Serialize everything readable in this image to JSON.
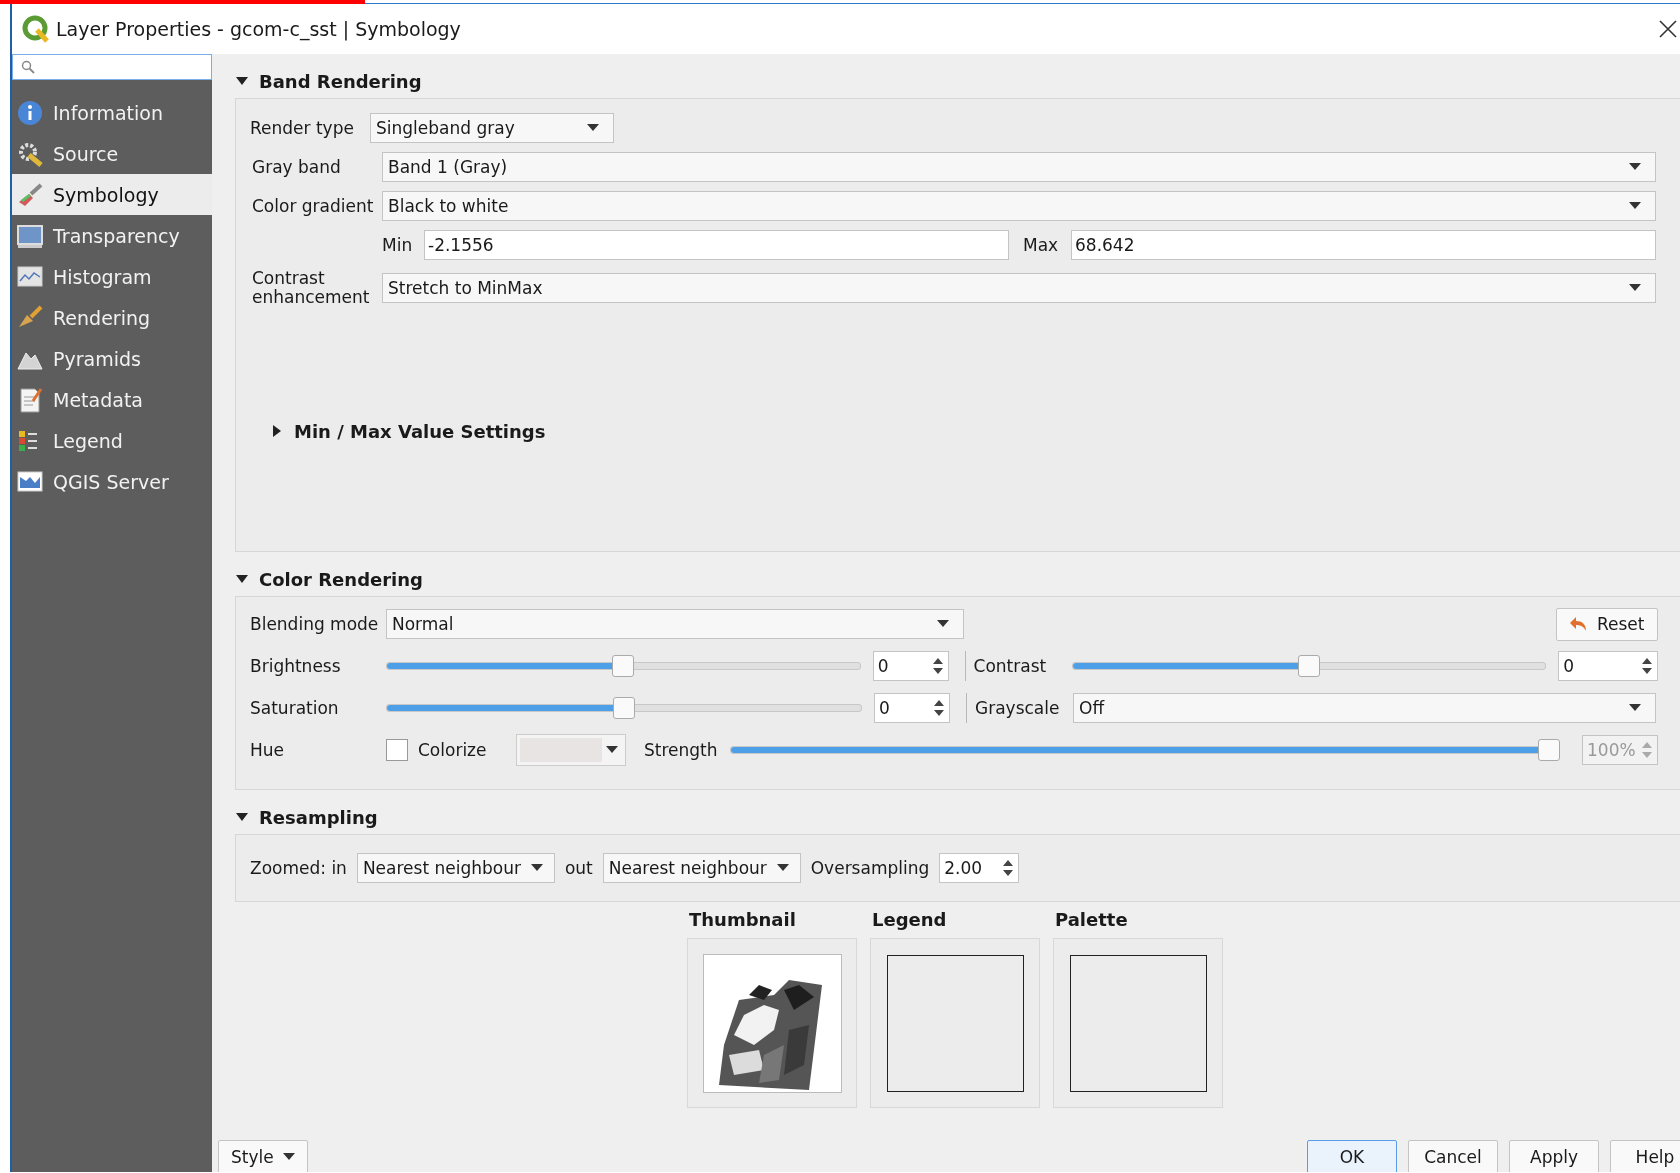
{
  "window": {
    "title": "Layer Properties - gcom-c_sst | Symbology"
  },
  "sidebar": {
    "items": [
      {
        "label": "Information",
        "selected": false
      },
      {
        "label": "Source",
        "selected": false
      },
      {
        "label": "Symbology",
        "selected": true
      },
      {
        "label": "Transparency",
        "selected": false
      },
      {
        "label": "Histogram",
        "selected": false
      },
      {
        "label": "Rendering",
        "selected": false
      },
      {
        "label": "Pyramids",
        "selected": false
      },
      {
        "label": "Metadata",
        "selected": false
      },
      {
        "label": "Legend",
        "selected": false
      },
      {
        "label": "QGIS Server",
        "selected": false
      }
    ]
  },
  "band_rendering": {
    "title": "Band Rendering",
    "expanded": true,
    "render_type": {
      "label": "Render type",
      "value": "Singleband gray"
    },
    "gray_band": {
      "label": "Gray band",
      "value": "Band 1 (Gray)"
    },
    "color_gradient": {
      "label": "Color gradient",
      "value": "Black to white"
    },
    "min": {
      "label": "Min",
      "value": "-2.1556"
    },
    "max": {
      "label": "Max",
      "value": "68.642"
    },
    "contrast_enhancement": {
      "label": "Contrast enhancement",
      "value": "Stretch to MinMax"
    },
    "min_max_settings": {
      "title": "Min / Max Value Settings",
      "expanded": false
    }
  },
  "color_rendering": {
    "title": "Color Rendering",
    "expanded": true,
    "blending_mode": {
      "label": "Blending mode",
      "value": "Normal"
    },
    "reset_button": "Reset",
    "brightness": {
      "label": "Brightness",
      "level": 0.5,
      "value": "0"
    },
    "contrast": {
      "label": "Contrast",
      "level": 0.5,
      "value": "0"
    },
    "saturation": {
      "label": "Saturation",
      "level": 0.5,
      "value": "0"
    },
    "grayscale": {
      "label": "Grayscale",
      "value": "Off"
    },
    "hue": {
      "label": "Hue",
      "colorize": {
        "label": "Colorize",
        "checked": false
      },
      "strength": {
        "label": "Strength",
        "level": 1,
        "value": "100%",
        "disabled": true
      }
    }
  },
  "resampling": {
    "title": "Resampling",
    "expanded": true,
    "zoomed_in": {
      "label": "Zoomed: in",
      "value": "Nearest neighbour"
    },
    "zoomed_out": {
      "label": "out",
      "value": "Nearest neighbour"
    },
    "oversampling": {
      "label": "Oversampling",
      "value": "2.00"
    }
  },
  "previews": [
    {
      "title": "Thumbnail",
      "kind": "picture"
    },
    {
      "title": "Legend",
      "kind": "empty"
    },
    {
      "title": "Palette",
      "kind": "empty"
    }
  ],
  "footer": {
    "style_button": "Style",
    "buttons": [
      {
        "label": "OK",
        "default": true
      },
      {
        "label": "Cancel",
        "default": false
      },
      {
        "label": "Apply",
        "default": false
      },
      {
        "label": "Help",
        "default": false
      }
    ]
  }
}
